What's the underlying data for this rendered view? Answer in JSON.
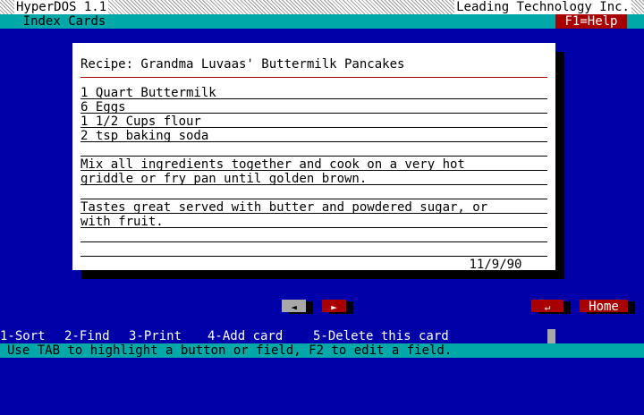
{
  "titlebar": {
    "app_name": "HyperDOS 1.1",
    "company": "Leading Technology Inc."
  },
  "subbar": {
    "stack_title": "Index Cards",
    "help": "F1=Help"
  },
  "card": {
    "title": "Recipe: Grandma Luvaas' Buttermilk Pancakes",
    "lines": [
      "1 Quart Buttermilk",
      "6 Eggs",
      "1 1/2 Cups flour",
      "2 tsp baking soda",
      "",
      "Mix all ingredients together and cook on a very hot",
      "griddle or fry pan until golden brown.",
      "",
      "Tastes great served with butter and powdered sugar, or",
      "with fruit.",
      "",
      ""
    ],
    "date": "11/9/90"
  },
  "buttons": {
    "prev": "◄",
    "next": "►",
    "return": "↵",
    "home": "Home"
  },
  "fkeys": {
    "sort": "1-Sort",
    "find": "2-Find",
    "print": "3-Print",
    "add": "4-Add card",
    "delete": "5-Delete this card"
  },
  "status": {
    "message": "Use TAB to highlight a button or field, F2 to edit a field."
  },
  "colors": {
    "background": "#0000a8",
    "bar": "#00a8a8",
    "accent_red": "#a80000",
    "card": "#ffffff"
  }
}
